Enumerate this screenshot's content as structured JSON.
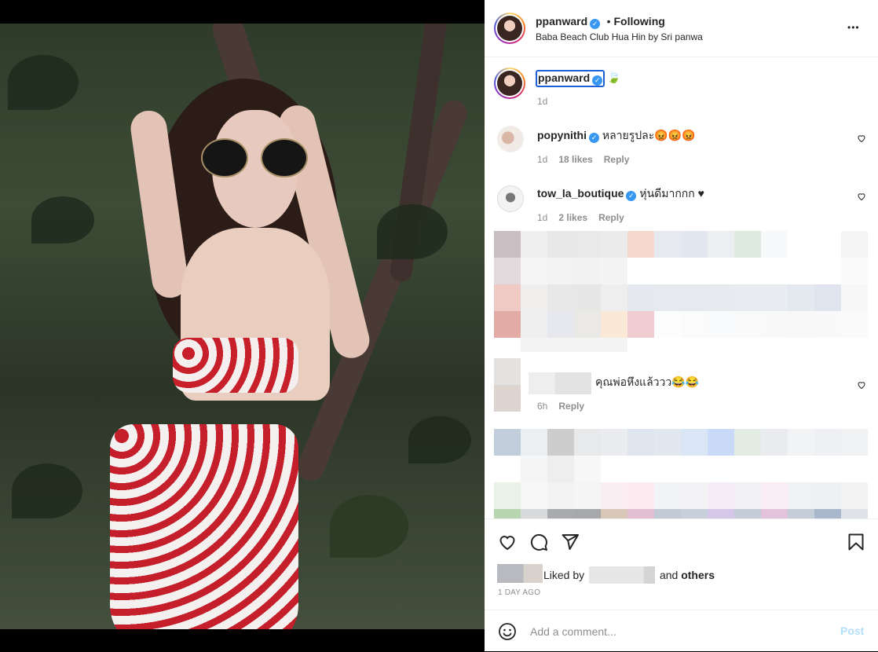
{
  "post": {
    "author": "ppanward",
    "follow_status": "Following",
    "location": "Baba Beach Club Hua Hin by Sri panwa",
    "caption_emoji": "🍃",
    "caption_time": "1d"
  },
  "comments": [
    {
      "user": "popynithi",
      "text": "หลายรูปละ😡😡😡",
      "time": "1d",
      "likes": "18 likes",
      "reply": "Reply"
    },
    {
      "user": "tow_la_boutique",
      "text": "หุ่นดีมากกก ♥",
      "time": "1d",
      "likes": "2 likes",
      "reply": "Reply"
    },
    {
      "user": "",
      "text": "คุณพ่อหึงแล้ววว😂😂",
      "time": "6h",
      "reply": "Reply"
    }
  ],
  "likes": {
    "prefix": "Liked by",
    "and": "and",
    "others": "others"
  },
  "timestamp": "1 DAY AGO",
  "comment_box": {
    "placeholder": "Add a comment...",
    "post_label": "Post"
  },
  "verified_mark": "✓",
  "more_dots": "•••",
  "colors": {
    "verified": "#3897f0",
    "post_disabled": "#b2dffc",
    "muted": "#8e8e8e"
  },
  "icons": [
    "like-icon",
    "comment-icon",
    "share-icon",
    "save-icon",
    "emoji-icon",
    "more-options-icon",
    "comment-like-icon"
  ]
}
